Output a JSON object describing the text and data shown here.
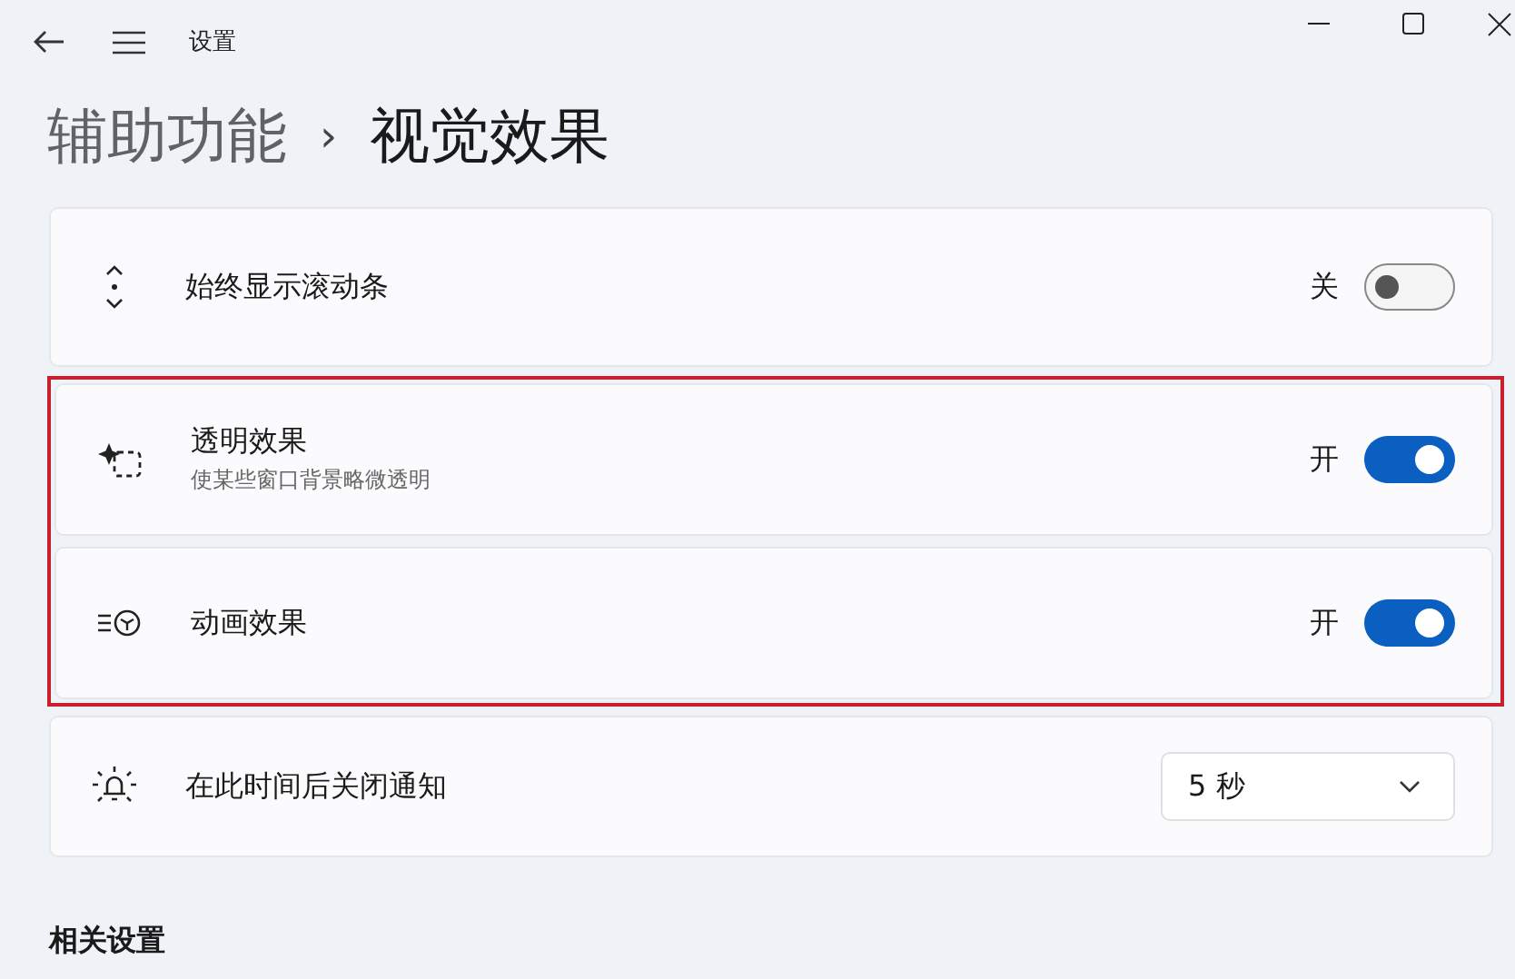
{
  "window": {
    "title": "设置"
  },
  "breadcrumb": {
    "parent": "辅助功能",
    "separator": "›",
    "current": "视觉效果"
  },
  "rows": [
    {
      "kind": "toggle",
      "label": "始终显示滚动条",
      "state_label": "关",
      "on": false,
      "highlighted": false
    },
    {
      "kind": "toggle",
      "label": "透明效果",
      "description": "使某些窗口背景略微透明",
      "state_label": "开",
      "on": true,
      "highlighted": true
    },
    {
      "kind": "toggle",
      "label": "动画效果",
      "state_label": "开",
      "on": true,
      "highlighted": true
    },
    {
      "kind": "dropdown",
      "label": "在此时间后关闭通知",
      "value": "5 秒",
      "highlighted": false
    }
  ],
  "section_heading": "相关设置"
}
